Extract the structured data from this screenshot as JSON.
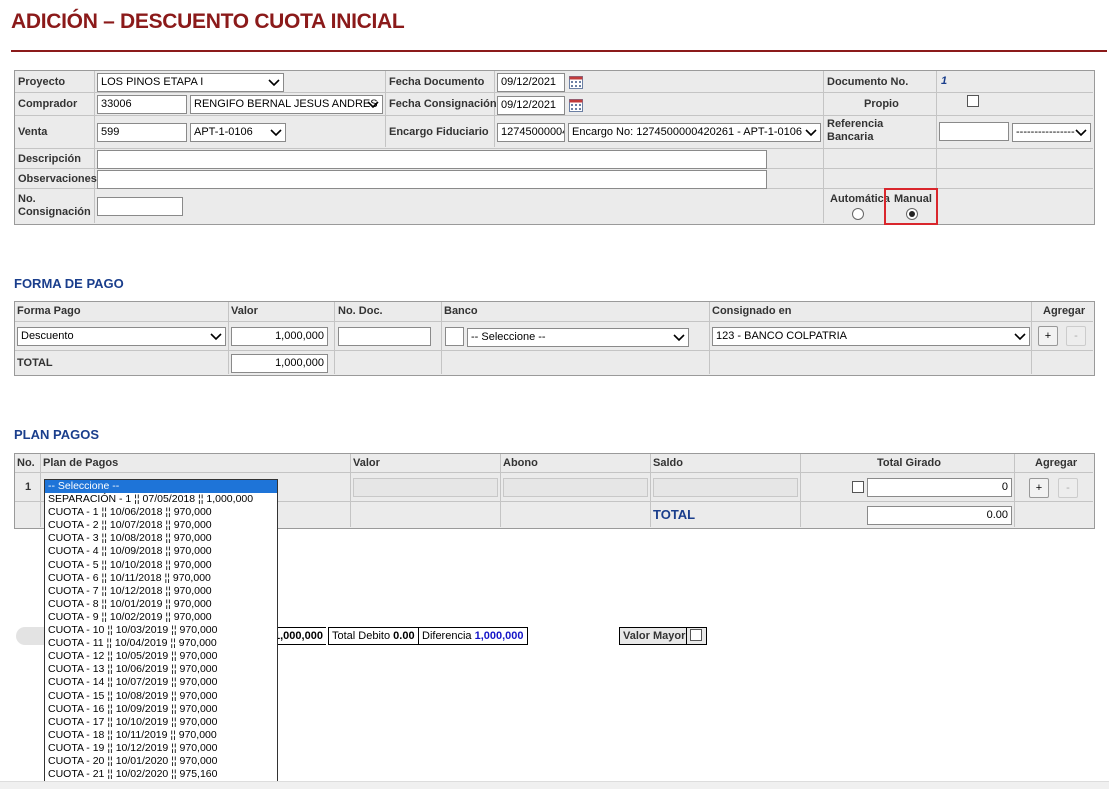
{
  "page": {
    "title": "ADICIÓN – DESCUENTO CUOTA INICIAL"
  },
  "header": {
    "proyecto_label": "Proyecto",
    "proyecto_value": "LOS PINOS ETAPA I",
    "comprador_label": "Comprador",
    "comprador_id": "33006",
    "comprador_name": "RENGIFO BERNAL JESUS ANDRES",
    "venta_label": "Venta",
    "venta_id": "599",
    "venta_apt": "APT-1-0106",
    "descripcion_label": "Descripción",
    "observaciones_label": "Observaciones",
    "consignacion_label": "No. Consignación",
    "fecha_documento_label": "Fecha Documento",
    "fecha_documento": "09/12/2021",
    "fecha_consignacion_label": "Fecha Consignación",
    "fecha_consignacion": "09/12/2021",
    "encargo_label": "Encargo Fiduciario",
    "encargo_value": "1274500000420261",
    "encargo_select": "Encargo No: 1274500000420261 - APT-1-0106",
    "documento_label": "Documento No.",
    "documento_value": "1",
    "propio_label": "Propio",
    "referencia_label": "Referencia Bancaria",
    "referencia_select": "----------------",
    "automatica_label": "Automática",
    "manual_label": "Manual",
    "mode_selected": "Manual"
  },
  "forma_pago": {
    "section_title": "FORMA DE PAGO",
    "headers": [
      "Forma Pago",
      "Valor",
      "No. Doc.",
      "Banco",
      "Consignado en",
      "Agregar"
    ],
    "forma": "Descuento",
    "valor": "1,000,000",
    "banco": "-- Seleccione --",
    "consignado": "123 - BANCO COLPATRIA",
    "total_label": "TOTAL",
    "total_value": "1,000,000",
    "add_label": "+",
    "remove_label": "-"
  },
  "plan_pagos": {
    "section_title": "PLAN PAGOS",
    "headers": [
      "No.",
      "Plan de Pagos",
      "Valor",
      "Abono",
      "Saldo",
      "Total Girado",
      "Agregar"
    ],
    "row_no": "1",
    "total_girado": "0",
    "total_label": "TOTAL",
    "total_value": "0.00",
    "add_label": "+",
    "remove_label": "-",
    "options": [
      "-- Seleccione --",
      "SEPARACIÓN - 1 ¦¦ 07/05/2018 ¦¦ 1,000,000",
      "CUOTA - 1 ¦¦ 10/06/2018 ¦¦ 970,000",
      "CUOTA - 2 ¦¦ 10/07/2018 ¦¦ 970,000",
      "CUOTA - 3 ¦¦ 10/08/2018 ¦¦ 970,000",
      "CUOTA - 4 ¦¦ 10/09/2018 ¦¦ 970,000",
      "CUOTA - 5 ¦¦ 10/10/2018 ¦¦ 970,000",
      "CUOTA - 6 ¦¦ 10/11/2018 ¦¦ 970,000",
      "CUOTA - 7 ¦¦ 10/12/2018 ¦¦ 970,000",
      "CUOTA - 8 ¦¦ 10/01/2019 ¦¦ 970,000",
      "CUOTA - 9 ¦¦ 10/02/2019 ¦¦ 970,000",
      "CUOTA - 10 ¦¦ 10/03/2019 ¦¦ 970,000",
      "CUOTA - 11 ¦¦ 10/04/2019 ¦¦ 970,000",
      "CUOTA - 12 ¦¦ 10/05/2019 ¦¦ 970,000",
      "CUOTA - 13 ¦¦ 10/06/2019 ¦¦ 970,000",
      "CUOTA - 14 ¦¦ 10/07/2019 ¦¦ 970,000",
      "CUOTA - 15 ¦¦ 10/08/2019 ¦¦ 970,000",
      "CUOTA - 16 ¦¦ 10/09/2019 ¦¦ 970,000",
      "CUOTA - 17 ¦¦ 10/10/2019 ¦¦ 970,000",
      "CUOTA - 18 ¦¦ 10/11/2019 ¦¦ 970,000",
      "CUOTA - 19 ¦¦ 10/12/2019 ¦¦ 970,000",
      "CUOTA - 20 ¦¦ 10/01/2020 ¦¦ 970,000",
      "CUOTA - 21 ¦¦ 10/02/2020 ¦¦ 975,160"
    ]
  },
  "summary": {
    "credito_value": "1,000,000",
    "debito_label": "Total Debito",
    "debito_value": "0.00",
    "diferencia_label": "Diferencia",
    "diferencia_value": "1,000,000",
    "valor_mayor_label": "Valor Mayor"
  },
  "colors": {
    "title": "#8b1a1a",
    "section": "#1a3e8c",
    "highlight": "#d9262c",
    "list_selected": "#1e74d8"
  }
}
